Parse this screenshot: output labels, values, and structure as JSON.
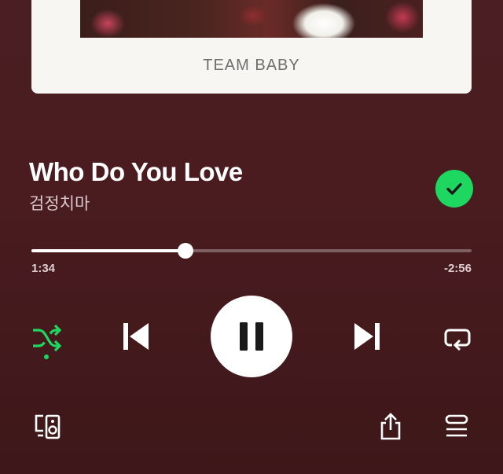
{
  "album": {
    "caption": "TEAM BABY"
  },
  "track": {
    "title": "Who Do You Love",
    "artist": "검정치마",
    "liked": true
  },
  "playback": {
    "elapsed": "1:34",
    "remaining": "-2:56",
    "progress": 0.35,
    "state": "playing",
    "shuffle": true,
    "repeat": false
  },
  "icons": {
    "liked": "check-circle-icon",
    "shuffle": "shuffle-icon",
    "previous": "skip-previous-icon",
    "playpause": "pause-icon",
    "next": "skip-next-icon",
    "repeat": "repeat-icon",
    "devices": "devices-icon",
    "share": "share-icon",
    "queue": "queue-icon"
  },
  "colors": {
    "accent": "#1ed760",
    "background": "#4a1e22"
  }
}
